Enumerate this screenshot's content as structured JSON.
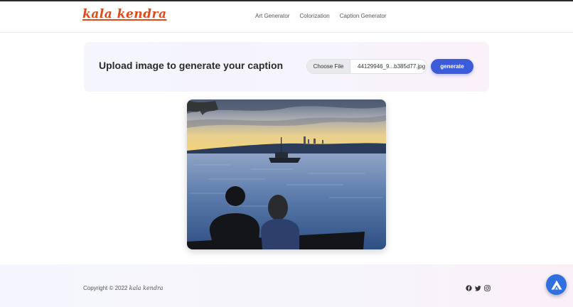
{
  "brand": {
    "logo_text": "kala kendra",
    "accent_color": "#e24a1b"
  },
  "nav": {
    "items": [
      {
        "label": "Art Generator"
      },
      {
        "label": "Colorization"
      },
      {
        "label": "Caption Generator"
      }
    ]
  },
  "upload": {
    "heading": "Upload image to generate your caption",
    "choose_file_label": "Choose File",
    "file_name": "44129946_9...b385d77.jpg",
    "generate_label": "generate",
    "button_color": "#3b5bdb"
  },
  "preview": {
    "icon": "uploaded-photo"
  },
  "footer": {
    "copyright_prefix": "Copyright © 2022",
    "copyright_brand": "kala kendra",
    "socials": [
      "facebook-icon",
      "twitter-icon",
      "instagram-icon"
    ]
  },
  "assistant": {
    "icon": "assistant-icon"
  }
}
